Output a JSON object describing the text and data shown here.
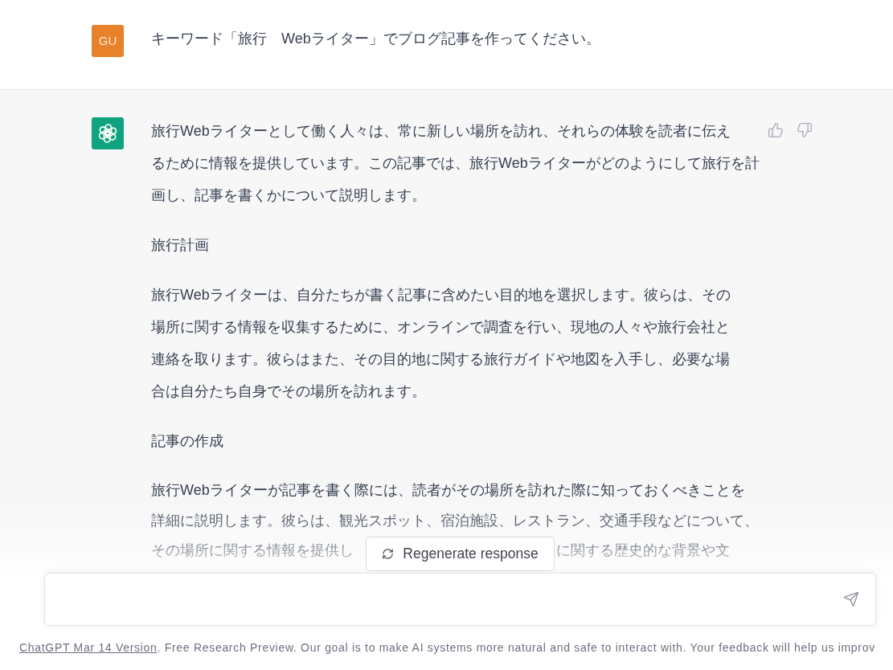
{
  "user_message": {
    "avatar": "GU",
    "text": "キーワード「旅行　Webライター」でブログ記事を作ってください。"
  },
  "assistant_message": {
    "paragraphs": [
      {
        "lines": [
          "旅行Webライターとして働く人々は、常に新しい場所を訪れ、それらの体験を読者に伝え",
          "るために情報を提供しています。この記事では、旅行Webライターがどのようにして旅行を計",
          "画し、記事を書くかについて説明します。"
        ]
      },
      {
        "lines": [
          "旅行計画"
        ]
      },
      {
        "lines": [
          "旅行Webライターは、自分たちが書く記事に含めたい目的地を選択します。彼らは、その",
          "場所に関する情報を収集するために、オンラインで調査を行い、現地の人々や旅行会社と",
          "連絡を取ります。彼らはまた、その目的地に関する旅行ガイドや地図を入手し、必要な場",
          "合は自分たち自身でその場所を訪れます。"
        ]
      },
      {
        "lines": [
          "記事の作成"
        ]
      },
      {
        "lines": [
          "旅行Webライターが記事を書く際には、読者がその場所を訪れた際に知っておくべきことを",
          "詳細に説明します。彼らは、観光スポット、宿泊施設、レストラン、交通手段などについて、"
        ],
        "covered_line": {
          "before": "その場所に関する情報を提供し",
          "after": "に関する歴史的な背景や文"
        }
      }
    ]
  },
  "regenerate_button": {
    "label": "Regenerate response"
  },
  "footer": {
    "link": "ChatGPT Mar 14 Version",
    "text": ". Free Research Preview. Our goal is to make AI systems more natural and safe to interact with. Your feedback will help us improv"
  }
}
